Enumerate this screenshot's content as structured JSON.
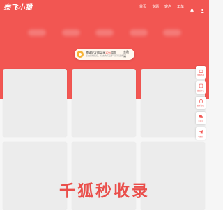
{
  "header": {
    "logo_text": "奈飞小猫",
    "nav": [
      {
        "label": "首页"
      },
      {
        "label": "专题"
      },
      {
        "label": "客户"
      },
      {
        "label": "工单"
      }
    ],
    "icons": [
      "bell-icon",
      "user-icon"
    ]
  },
  "notice": {
    "line1_prefix": "邀请好友购买享",
    "line1_highlight": "10%",
    "line1_suffix": "佣金",
    "line2": "点击复制链接，好友购买后即可获得返佣",
    "button": "去邀请"
  },
  "sidebar": {
    "items": [
      {
        "label": "优惠活动",
        "icon": "gift-icon"
      },
      {
        "label": "邀请有礼",
        "icon": "invite-icon"
      },
      {
        "label": "联系客服",
        "icon": "headset-icon"
      },
      {
        "label": "公众号",
        "icon": "wechat-icon"
      },
      {
        "label": "电报群",
        "icon": "telegram-icon"
      }
    ]
  },
  "watermark": "千狐秒收录",
  "colors": {
    "brand": "#f25652",
    "card": "#ececec",
    "background": "#f6f6f6"
  }
}
